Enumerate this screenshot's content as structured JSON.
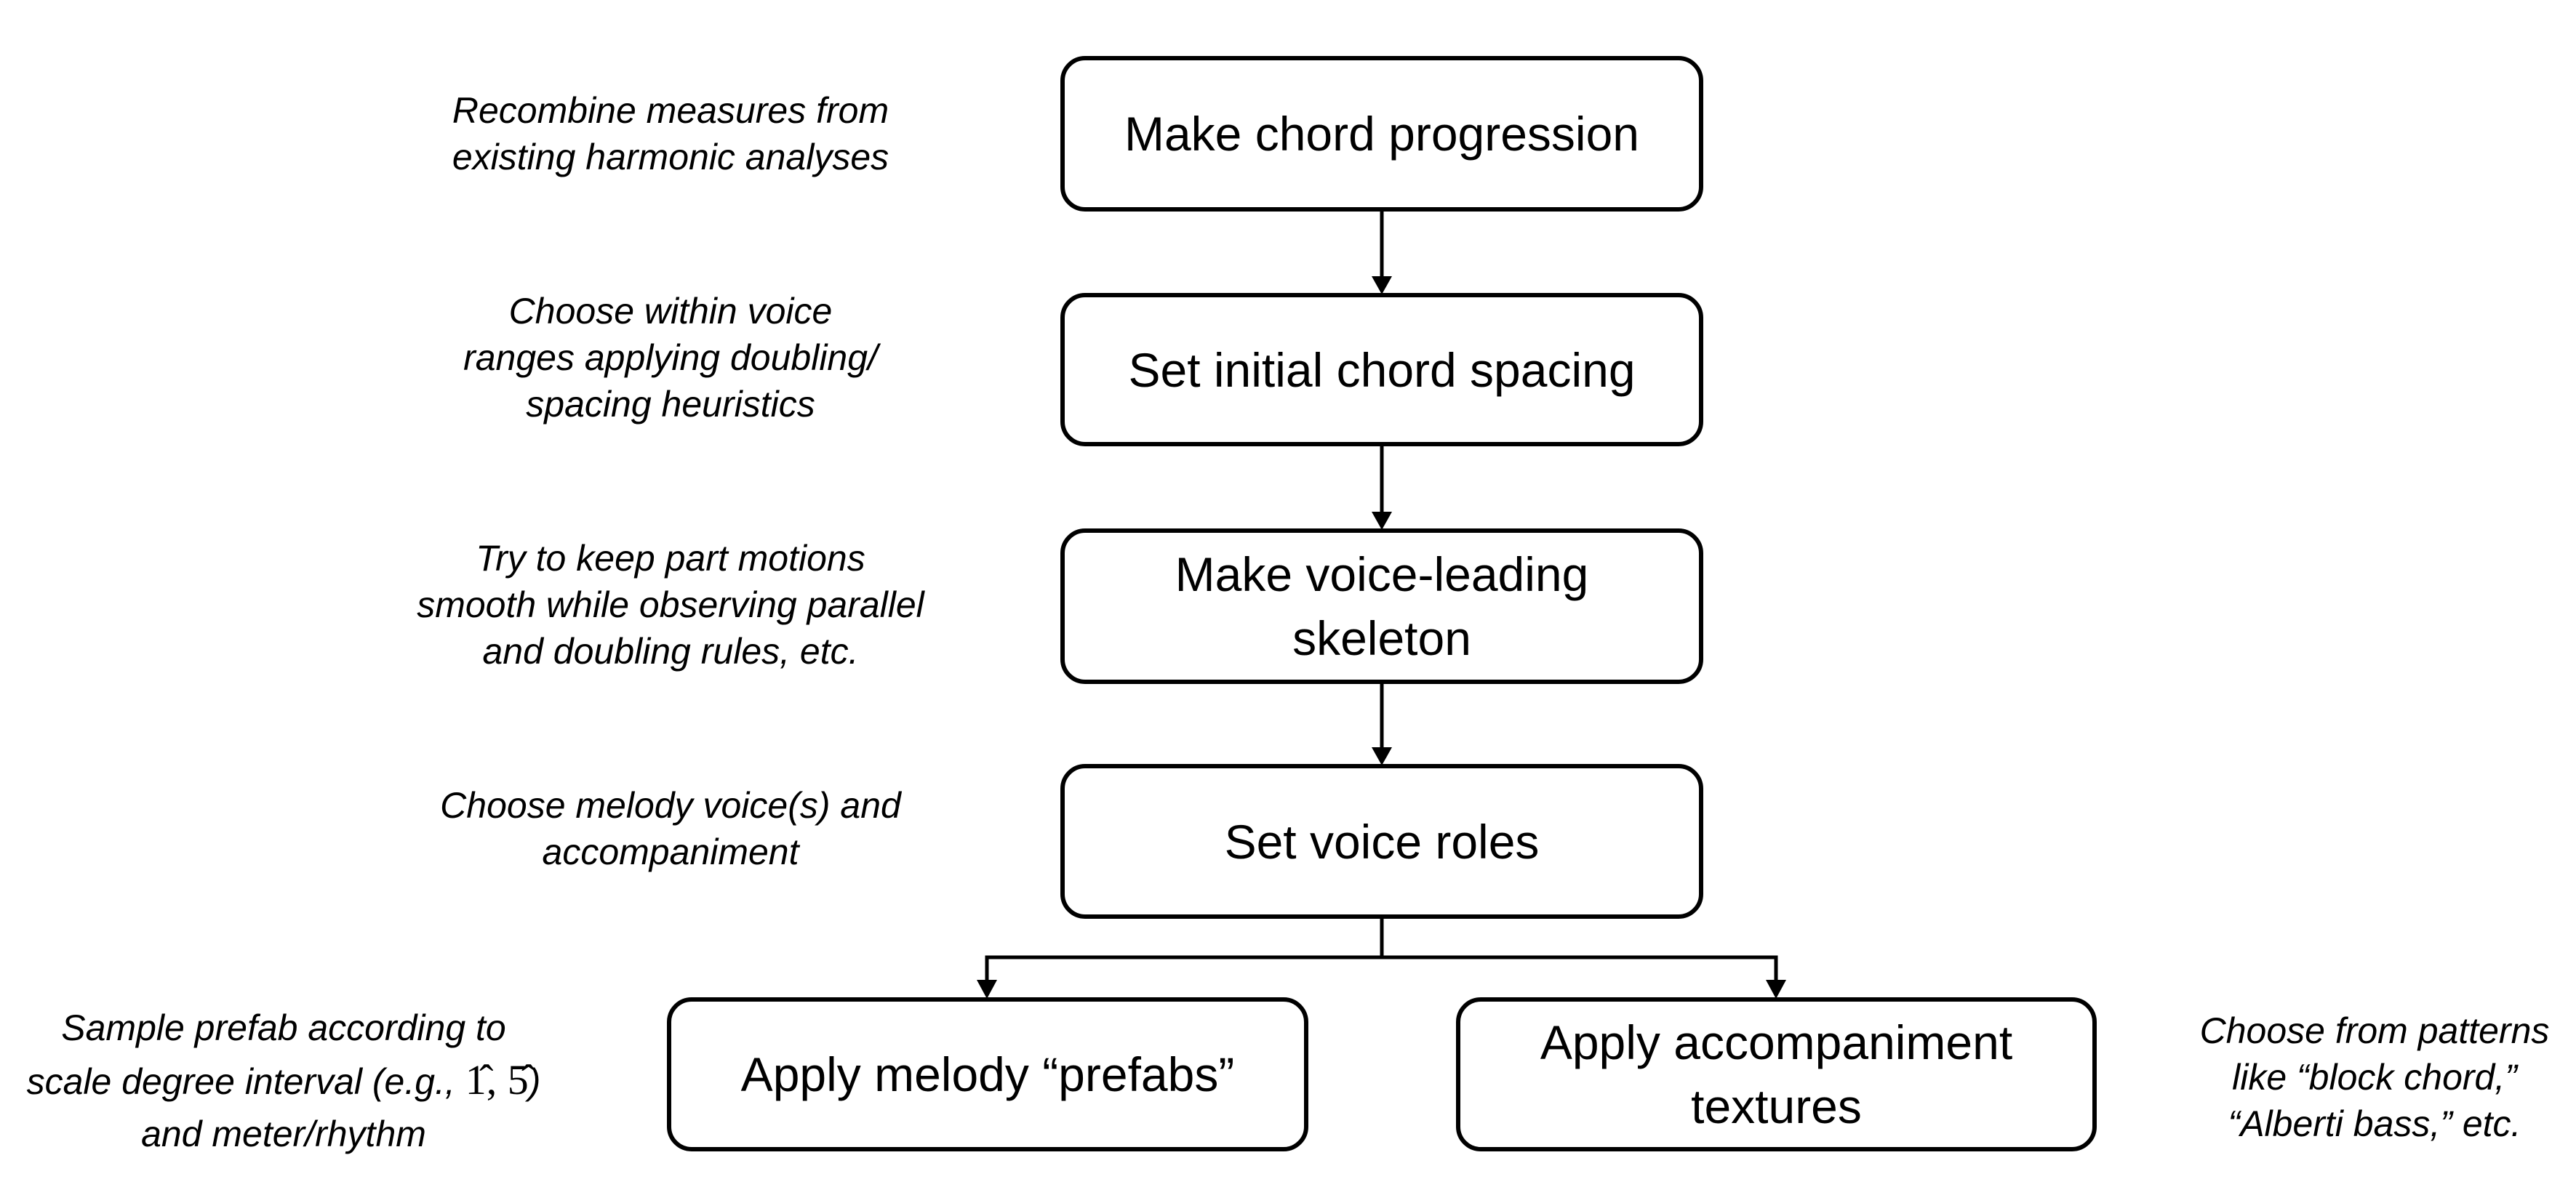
{
  "diagram": {
    "type": "flowchart",
    "colors": {
      "stroke": "#000000",
      "background": "#ffffff",
      "text": "#000000"
    },
    "steps": [
      {
        "id": "chord-progression",
        "lines": [
          "Make chord progression"
        ]
      },
      {
        "id": "chord-spacing",
        "lines": [
          "Set initial chord spacing"
        ]
      },
      {
        "id": "voice-leading",
        "lines": [
          "Make voice-leading",
          "skeleton"
        ]
      },
      {
        "id": "voice-roles",
        "lines": [
          "Set voice roles"
        ]
      },
      {
        "id": "melody-prefabs",
        "lines": [
          "Apply melody “prefabs”"
        ]
      },
      {
        "id": "accompaniment-textures",
        "lines": [
          "Apply accompaniment",
          "textures"
        ]
      }
    ],
    "edges": [
      {
        "from": "chord-progression",
        "to": "chord-spacing"
      },
      {
        "from": "chord-spacing",
        "to": "voice-leading"
      },
      {
        "from": "voice-leading",
        "to": "voice-roles"
      },
      {
        "from": "voice-roles",
        "to": "melody-prefabs"
      },
      {
        "from": "voice-roles",
        "to": "accompaniment-textures"
      }
    ],
    "annotations": [
      {
        "for": "chord-progression",
        "lines": [
          "Recombine measures from",
          "existing harmonic analyses"
        ]
      },
      {
        "for": "chord-spacing",
        "lines": [
          "Choose within voice",
          "ranges applying doubling/",
          "spacing heuristics"
        ]
      },
      {
        "for": "voice-leading",
        "lines": [
          "Try to keep part motions",
          "smooth while observing parallel",
          "and doubling rules, etc."
        ]
      },
      {
        "for": "voice-roles",
        "lines": [
          "Choose melody voice(s) and",
          "accompaniment"
        ]
      },
      {
        "for": "melody-prefabs",
        "lines": [
          "Sample prefab according to",
          "scale degree interval (e.g., ",
          "and meter/rhythm"
        ],
        "math": "1̂, 5̂",
        "math_suffix": ")"
      },
      {
        "for": "accompaniment-textures",
        "lines": [
          "Choose from patterns",
          "like “block chord,”",
          "“Alberti bass,” etc."
        ]
      }
    ]
  }
}
